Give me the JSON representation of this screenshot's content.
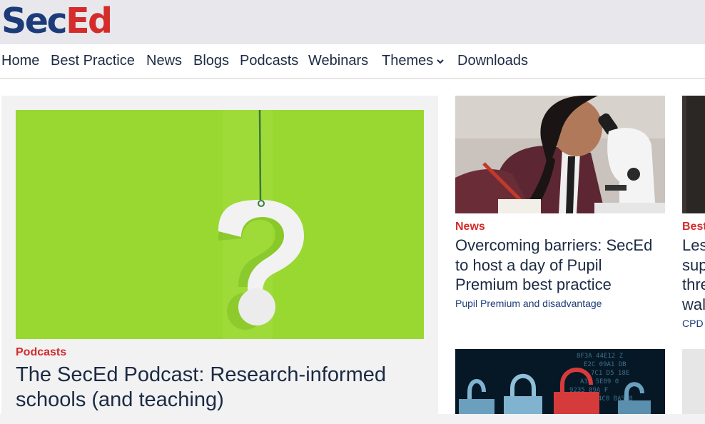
{
  "brand": {
    "logo_sec": "Sec",
    "logo_ed": "Ed"
  },
  "nav": {
    "items": [
      "Home",
      "Best Practice",
      "News",
      "Blogs",
      "Podcasts",
      "Webinars",
      "Themes",
      "Downloads"
    ]
  },
  "feature": {
    "category": "Podcasts",
    "title": "The SecEd Podcast: Research-informed schools (and teaching)",
    "image": "question-mark-illustration"
  },
  "cards": [
    {
      "category": "News",
      "title": "Overcoming barriers: SecEd to host a day of Pupil Premium best practice",
      "tag": "Pupil Premium and disadvantage",
      "image": "student-microscope-photo"
    },
    {
      "category": "Best",
      "title_lines": [
        "Les",
        "sup",
        "thre",
        "wal"
      ],
      "tag": "CPD",
      "image": "dark-photo"
    },
    {
      "image": "padlock-cyber-photo"
    }
  ],
  "colors": {
    "brand_blue": "#1c3b78",
    "brand_red": "#d42b2b",
    "feature_green": "#98d830"
  }
}
